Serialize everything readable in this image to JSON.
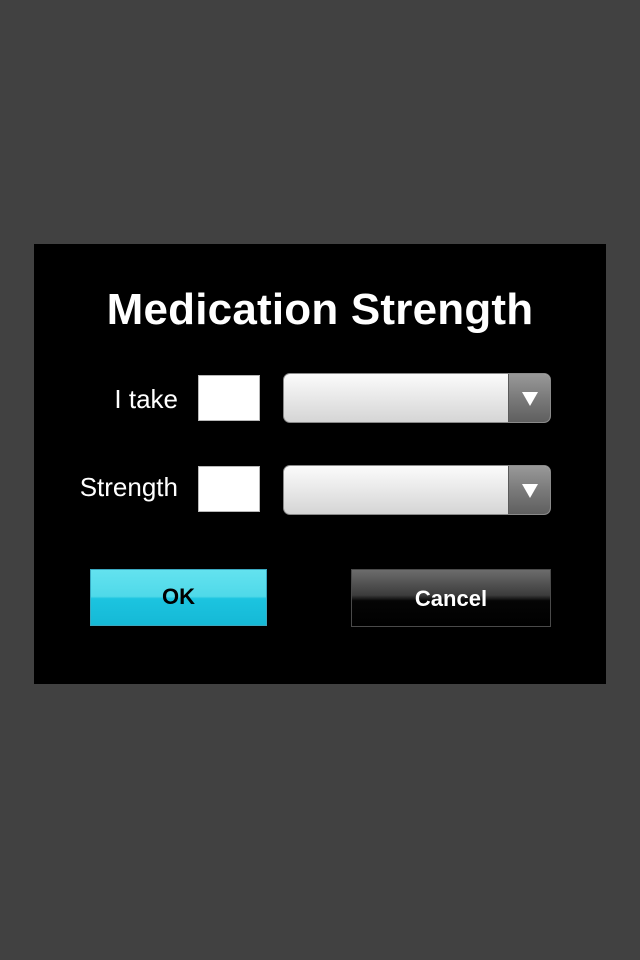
{
  "dialog": {
    "title": "Medication Strength",
    "rows": [
      {
        "label": "I take",
        "quantity_value": "",
        "select_value": ""
      },
      {
        "label": "Strength",
        "quantity_value": "",
        "select_value": ""
      }
    ],
    "buttons": {
      "ok_label": "OK",
      "cancel_label": "Cancel"
    }
  },
  "icons": {
    "dropdown": "chevron-down-icon"
  },
  "colors": {
    "background": "#414141",
    "dialog": "#000000",
    "ok_accent": "#1cc4e0"
  }
}
